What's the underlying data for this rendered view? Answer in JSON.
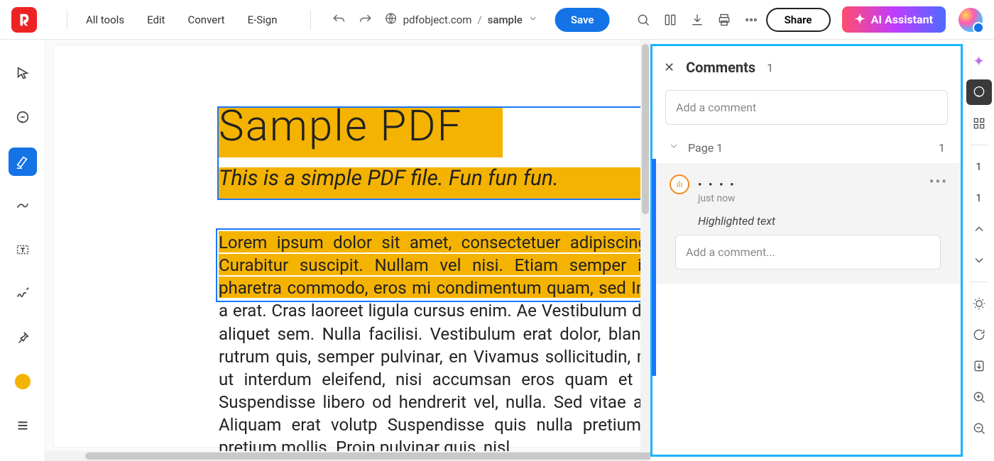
{
  "header": {
    "menu": {
      "all_tools": "All tools",
      "edit": "Edit",
      "convert": "Convert",
      "esign": "E-Sign"
    },
    "breadcrumb": {
      "domain": "pdfobject.com",
      "file": "sample"
    },
    "save_label": "Save",
    "share_label": "Share",
    "ai_label": "AI Assistant"
  },
  "document": {
    "title": "Sample PDF",
    "subtitle": "This is a simple PDF file. Fun fun fun.",
    "body_text": "Lorem ipsum dolor sit amet, consectetuer adipiscing elit. Curabitur suscipit. Nullam vel nisi. Etiam semper ipsum pharetra commodo, eros mi condimentum quam, sed Integer a erat. Cras laoreet ligula cursus enim. Ae Vestibulum dictum aliquet sem. Nulla facilisi. Vestibulum erat dolor, blandit in, rutrum quis, semper pulvinar, en Vivamus sollicitudin, metus ut interdum eleifend, nisi accumsan eros quam et risus. Suspendisse libero od hendrerit vel, nulla. Sed vitae augue. Aliquam erat volutp Suspendisse quis nulla pretium ante pretium mollis. Proin pulvinar quis, nisl."
  },
  "comments": {
    "panel_title": "Comments",
    "count": "1",
    "add_placeholder": "Add a comment",
    "page_label": "Page 1",
    "page_count": "1",
    "item": {
      "user": "• • • •",
      "time": "just now",
      "note": "Highlighted text",
      "reply_placeholder": "Add a comment..."
    }
  },
  "right_rail": {
    "page_current": "1",
    "page_total": "1"
  },
  "colors": {
    "highlight": "#f5b301",
    "accent": "#1473e6",
    "panel_border": "#19b6ff"
  }
}
